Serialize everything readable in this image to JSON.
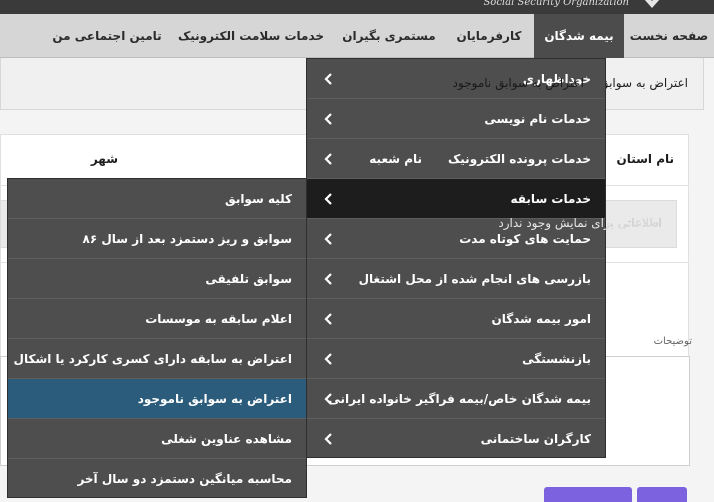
{
  "header": {
    "org_name": "Social Security Organization"
  },
  "nav": {
    "items": [
      {
        "label": "صفحه نخست"
      },
      {
        "label": "بیمه شدگان"
      },
      {
        "label": "کارفرمایان"
      },
      {
        "label": "مستمری بگیران"
      },
      {
        "label": "خدمات سلامت الکترونیک"
      },
      {
        "label": "تامین اجتماعی من"
      }
    ],
    "active_index": 1
  },
  "page": {
    "notice": "اعتراض به سوابق ناموجود",
    "columns": [
      "نام استان",
      "نام شعبه",
      "شهر"
    ],
    "empty_message": "اطلاعاتی برای نمایش وجود ندارد",
    "description_label": "توضیحات"
  },
  "menu_primary": {
    "items": [
      {
        "label": "خوداظهاری"
      },
      {
        "label": "خدمات نام نویسی"
      },
      {
        "label": "خدمات پرونده الکترونیک"
      },
      {
        "label": "خدمات سابقه"
      },
      {
        "label": "حمایت های کوتاه مدت"
      },
      {
        "label": "بازرسی های انجام شده از محل اشتغال"
      },
      {
        "label": "امور بیمه شدگان"
      },
      {
        "label": "بازنشستگی"
      },
      {
        "label": "بیمه شدگان خاص/بیمه فراگیر خانواده ایرانی"
      },
      {
        "label": "کارگران ساختمانی"
      }
    ],
    "highlighted_index": 3
  },
  "menu_secondary": {
    "items": [
      {
        "label": "کلیه سوابق"
      },
      {
        "label": "سوابق و ریز دستمزد بعد از سال ۸۶"
      },
      {
        "label": "سوابق تلفیقی"
      },
      {
        "label": "اعلام سابقه به موسسات"
      },
      {
        "label": "اعتراض به سابقه دارای کسری کارکرد یا اشکال"
      },
      {
        "label": "اعتراض به سوابق ناموجود"
      },
      {
        "label": "مشاهده عناوین شغلی"
      },
      {
        "label": "محاسبه میانگین دستمزد دو سال آخر"
      }
    ],
    "selected_index": 5
  },
  "colors": {
    "nav_bg": "#d6d6d6",
    "nav_active": "#4c4c4c",
    "menu_bg": "#4e4e4e",
    "menu_highlight": "#1d1d1d",
    "menu_selected": "#2b5c7b",
    "accent_button": "#7d62e0"
  }
}
